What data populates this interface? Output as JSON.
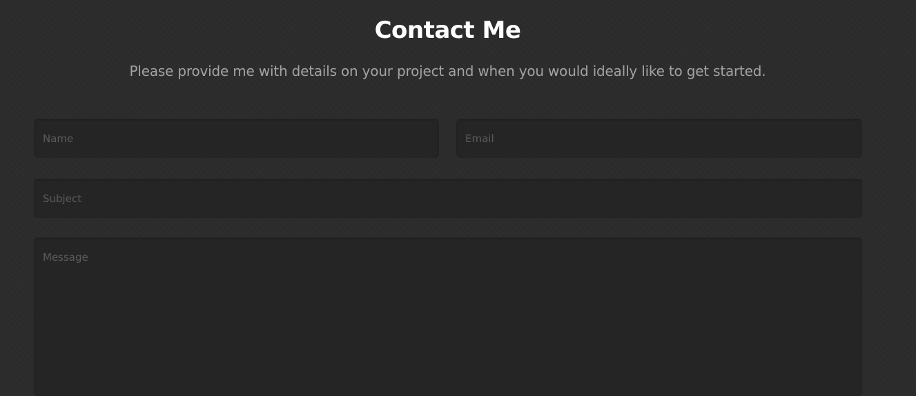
{
  "contact": {
    "title": "Contact Me",
    "subtitle": "Please provide me with details on your project and when you would ideally like to get started.",
    "fields": {
      "name": {
        "placeholder": "Name",
        "value": ""
      },
      "email": {
        "placeholder": "Email",
        "value": ""
      },
      "subject": {
        "placeholder": "Subject",
        "value": ""
      },
      "message": {
        "placeholder": "Message",
        "value": ""
      }
    }
  },
  "colors": {
    "background": "#2c2c2c",
    "field_background": "#252525",
    "title": "#ffffff",
    "subtitle": "#a3a3a3",
    "placeholder": "#5c5c5c"
  }
}
